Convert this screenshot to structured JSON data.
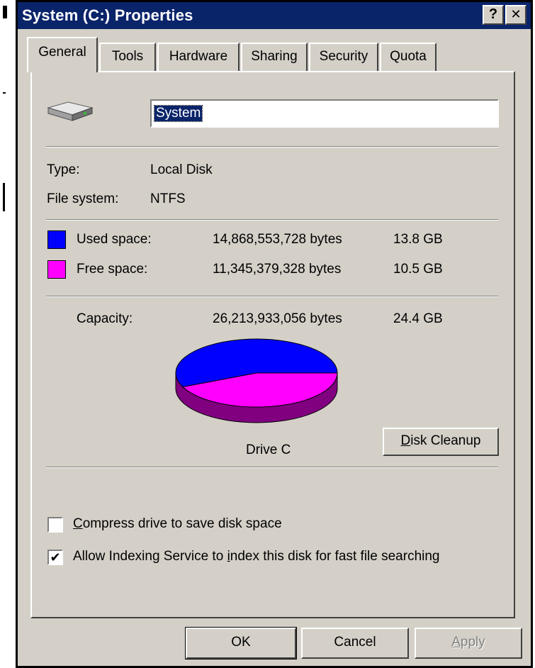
{
  "window": {
    "title": "System (C:) Properties",
    "help_button": "?",
    "close_button": "✕"
  },
  "tabs": [
    {
      "label": "General",
      "active": true
    },
    {
      "label": "Tools",
      "active": false
    },
    {
      "label": "Hardware",
      "active": false
    },
    {
      "label": "Sharing",
      "active": false
    },
    {
      "label": "Security",
      "active": false
    },
    {
      "label": "Quota",
      "active": false
    }
  ],
  "general": {
    "drive_icon": "hard-drive-icon",
    "volume_label": "System",
    "type_label": "Type:",
    "type_value": "Local Disk",
    "fs_label": "File system:",
    "fs_value": "NTFS",
    "used": {
      "label": "Used space:",
      "bytes": "14,868,553,728 bytes",
      "size": "13.8 GB",
      "color": "#0000ff"
    },
    "free": {
      "label": "Free space:",
      "bytes": "11,345,379,328 bytes",
      "size": "10.5 GB",
      "color": "#ff00ff"
    },
    "capacity": {
      "label": "Capacity:",
      "bytes": "26,213,933,056 bytes",
      "size": "24.4 GB"
    },
    "drive_caption": "Drive C",
    "disk_cleanup_prefix": "D",
    "disk_cleanup_rest": "isk Cleanup",
    "compress_prefix": "C",
    "compress_rest": "ompress drive to save disk space",
    "compress_checked": false,
    "index_before": "Allow Indexing Service to ",
    "index_mnemonic": "i",
    "index_after": "ndex this disk for fast file searching",
    "index_checked": true,
    "check_mark": "✔"
  },
  "chart_data": {
    "type": "pie",
    "categories": [
      "Used space",
      "Free space"
    ],
    "values": [
      14868553728,
      11345379328
    ],
    "colors": [
      "#0000ff",
      "#ff00ff"
    ],
    "title": "Drive C"
  },
  "buttons": {
    "ok": "OK",
    "cancel": "Cancel",
    "apply_prefix": "A",
    "apply_rest": "pply"
  }
}
